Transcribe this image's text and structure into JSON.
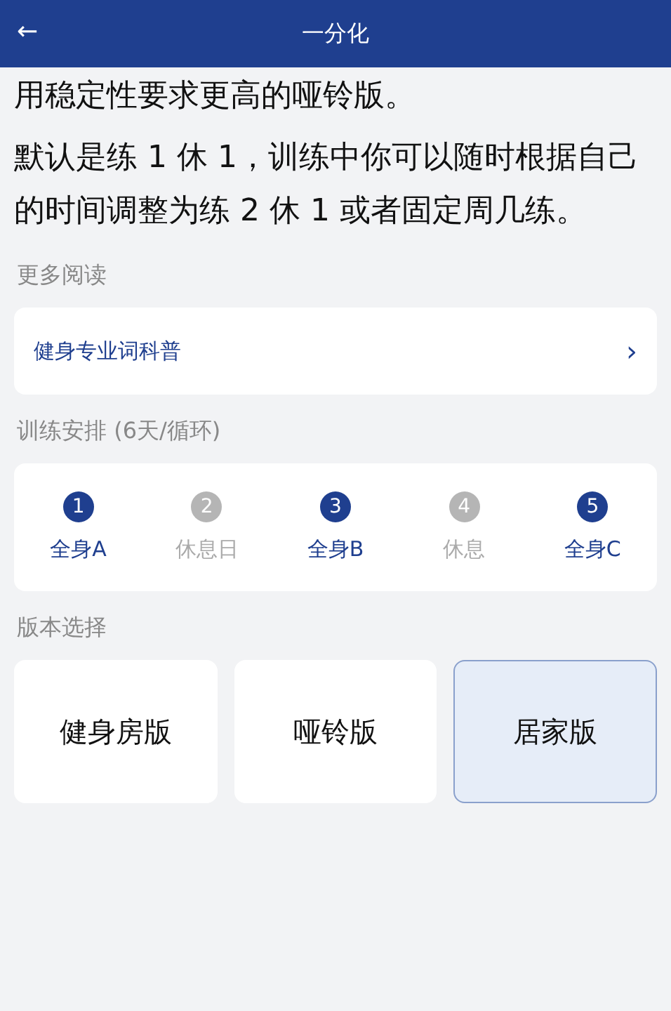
{
  "header": {
    "back": "←",
    "title": "一分化"
  },
  "paragraphs": [
    "用稳定性要求更高的哑铃版。",
    "默认是练 1 休 1，训练中你可以随时根据自己的时间调整为练 2 休 1 或者固定周几练。"
  ],
  "more_reading": {
    "label": "更多阅读",
    "link": "健身专业词科普",
    "chevron": "›"
  },
  "schedule": {
    "label": "训练安排 (6天/循环)",
    "days": [
      {
        "number": "1",
        "name": "全身A",
        "kind": "train"
      },
      {
        "number": "2",
        "name": "休息日",
        "kind": "rest"
      },
      {
        "number": "3",
        "name": "全身B",
        "kind": "train"
      },
      {
        "number": "4",
        "name": "休息",
        "kind": "rest"
      },
      {
        "number": "5",
        "name": "全身C",
        "kind": "train"
      }
    ]
  },
  "versions": {
    "label": "版本选择",
    "options": [
      {
        "name": "健身房版",
        "selected": false
      },
      {
        "name": "哑铃版",
        "selected": false
      },
      {
        "name": "居家版",
        "selected": true
      }
    ]
  }
}
